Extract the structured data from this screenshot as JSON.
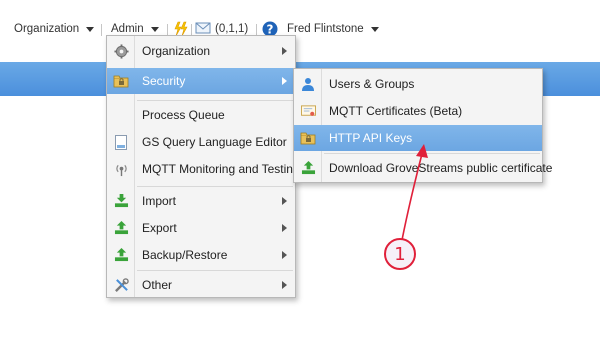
{
  "topbar": {
    "organization_label": "Organization",
    "admin_label": "Admin",
    "stats_text": "(0,1,1)",
    "user_label": "Fred Flintstone"
  },
  "admin_menu": {
    "items": [
      {
        "label": "Organization",
        "icon": "gear-icon",
        "submenu": true
      },
      {
        "label": "Security",
        "icon": "lock-folder-icon",
        "submenu": true,
        "active": true
      },
      {
        "label": "Process Queue",
        "icon": "",
        "submenu": false
      },
      {
        "label": "GS Query Language Editor",
        "icon": "document-icon",
        "submenu": false
      },
      {
        "label": "MQTT Monitoring and Testing",
        "icon": "broadcast-icon",
        "submenu": false
      },
      {
        "label": "Import",
        "icon": "import-icon",
        "submenu": true
      },
      {
        "label": "Export",
        "icon": "export-icon",
        "submenu": true
      },
      {
        "label": "Backup/Restore",
        "icon": "backup-icon",
        "submenu": true
      },
      {
        "label": "Other",
        "icon": "tools-icon",
        "submenu": true
      }
    ]
  },
  "security_menu": {
    "items": [
      {
        "label": "Users & Groups",
        "icon": "users-icon"
      },
      {
        "label": "MQTT Certificates (Beta)",
        "icon": "certificate-icon"
      },
      {
        "label": "HTTP API Keys",
        "icon": "key-folder-icon",
        "active": true
      },
      {
        "label": "Download GroveStreams public certificate",
        "icon": "download-icon"
      }
    ]
  },
  "annotation": {
    "step_number": "1",
    "color": "#e0203a"
  },
  "colors": {
    "accent_blue": "#4b8fdc",
    "menu_highlight": "#6ca6e2",
    "arrow_red": "#e0203a"
  }
}
